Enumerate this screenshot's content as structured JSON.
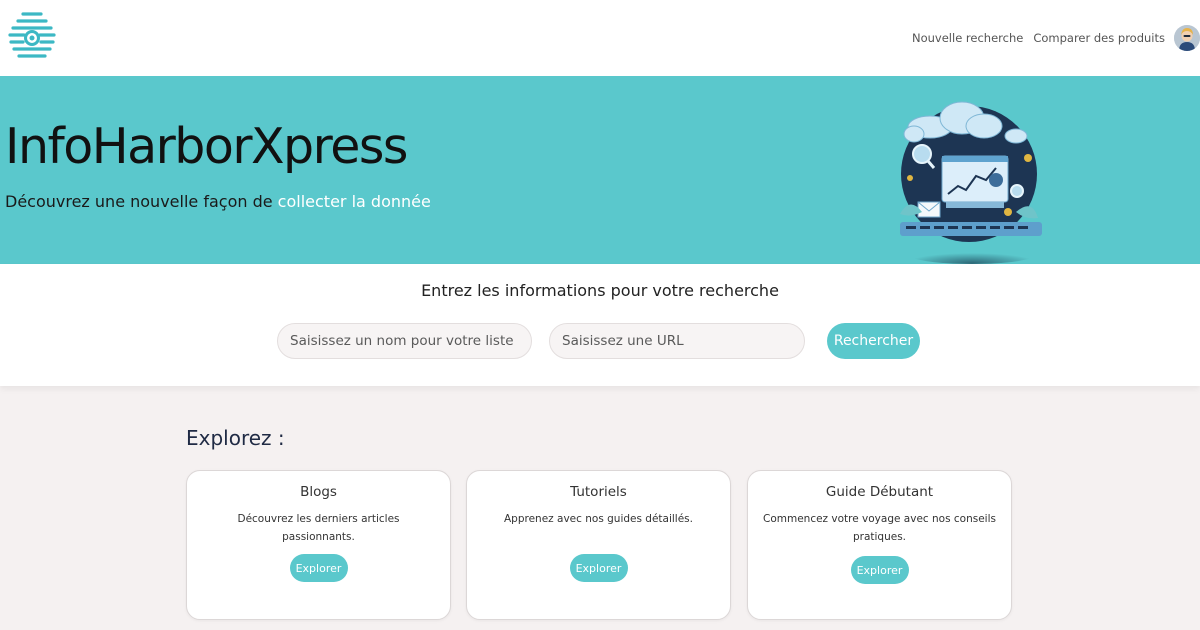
{
  "brand": {
    "logo_icon": "beehive-icon",
    "accent_color": "#5ac8cc"
  },
  "nav": {
    "items": [
      {
        "label": "Nouvelle recherche"
      },
      {
        "label": "Comparer des produits"
      }
    ],
    "avatar_icon": "user-avatar"
  },
  "hero": {
    "title": "InfoHarborXpress",
    "subtitle_prefix": "Découvrez une nouvelle façon de ",
    "subtitle_highlight": "collecter la donnée",
    "illustration": "cloud-analytics-illustration"
  },
  "search": {
    "heading": "Entrez les informations pour votre recherche",
    "name_placeholder": "Saisissez un nom pour votre liste",
    "url_placeholder": "Saisissez une URL",
    "button_label": "Rechercher"
  },
  "explore": {
    "title": "Explorez :",
    "cards": [
      {
        "title": "Blogs",
        "text": "Découvrez les derniers articles passionnants.",
        "button": "Explorer"
      },
      {
        "title": "Tutoriels",
        "text": "Apprenez avec nos guides détaillés.",
        "button": "Explorer"
      },
      {
        "title": "Guide Débutant",
        "text": "Commencez votre voyage avec nos conseils pratiques.",
        "button": "Explorer"
      }
    ]
  }
}
